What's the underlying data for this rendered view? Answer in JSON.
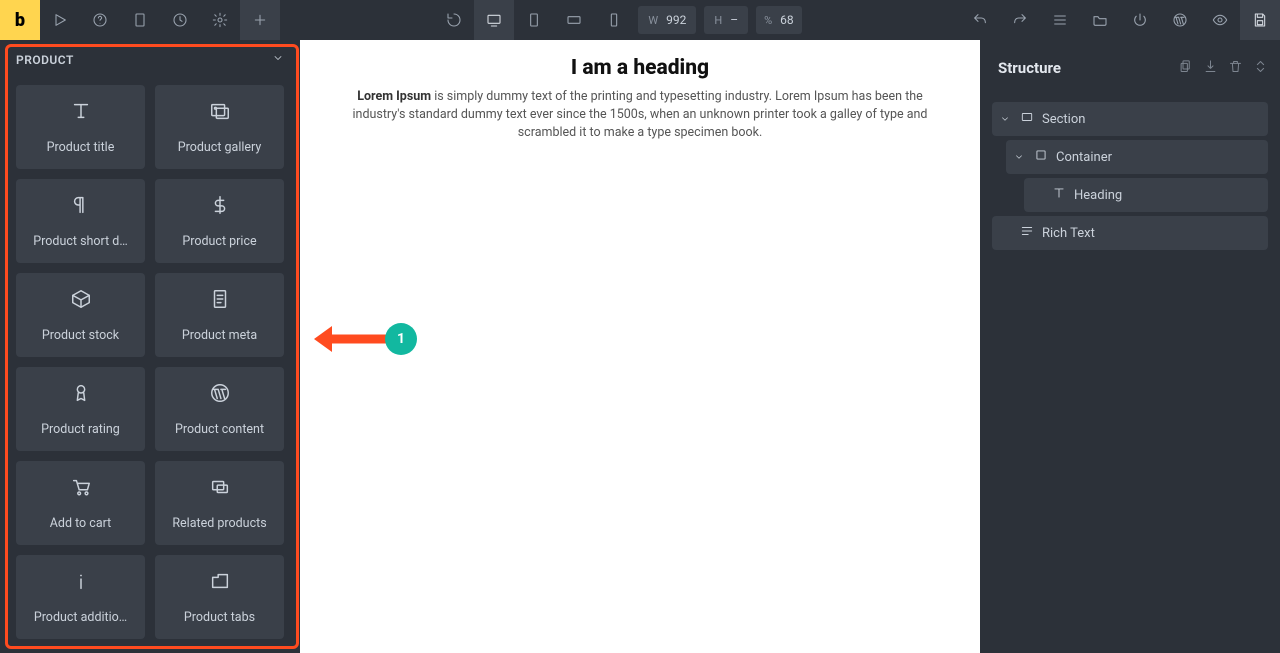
{
  "logo": "b",
  "toolbar": {
    "dims": {
      "w_label": "W",
      "w": "992",
      "h_label": "H",
      "h": "–",
      "pct_label": "%",
      "pct": "68"
    }
  },
  "panel": {
    "title": "PRODUCT",
    "items": [
      {
        "label": "Product title"
      },
      {
        "label": "Product gallery"
      },
      {
        "label": "Product short d…"
      },
      {
        "label": "Product price"
      },
      {
        "label": "Product stock"
      },
      {
        "label": "Product meta"
      },
      {
        "label": "Product rating"
      },
      {
        "label": "Product content"
      },
      {
        "label": "Add to cart"
      },
      {
        "label": "Related products"
      },
      {
        "label": "Product additio…"
      },
      {
        "label": "Product tabs"
      }
    ]
  },
  "canvas": {
    "heading": "I am a heading",
    "text_strong": "Lorem Ipsum",
    "text_rest": " is simply dummy text of the printing and typesetting industry. Lorem Ipsum has been the industry's standard dummy text ever since the 1500s, when an unknown printer took a galley of type and scrambled it to make a type specimen book."
  },
  "annotation": {
    "badge": "1"
  },
  "structure": {
    "title": "Structure",
    "tree": [
      {
        "label": "Section"
      },
      {
        "label": "Container"
      },
      {
        "label": "Heading"
      },
      {
        "label": "Rich Text"
      }
    ]
  }
}
